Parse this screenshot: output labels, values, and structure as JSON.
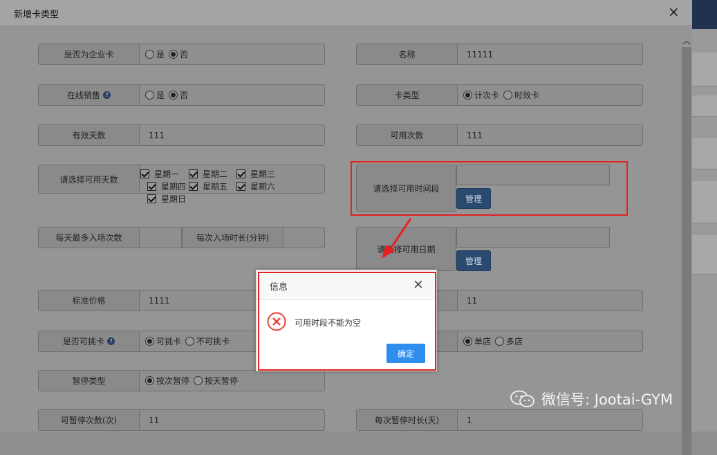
{
  "dialog": {
    "title": "新增卡类型",
    "close_glyph": "×"
  },
  "scroll_up_glyph": "︿",
  "form": {
    "enterprise": {
      "label": "是否为企业卡",
      "options": [
        "是",
        "否"
      ],
      "selected": "否"
    },
    "name": {
      "label": "名称",
      "value": "11111"
    },
    "online_sale": {
      "label": "在线销售",
      "help": "?",
      "options": [
        "是",
        "否"
      ],
      "selected": "否"
    },
    "card_type": {
      "label": "卡类型",
      "options": [
        "计次卡",
        "时效卡"
      ],
      "selected": "计次卡"
    },
    "valid_days": {
      "label": "有效天数",
      "value": "111"
    },
    "usable_times": {
      "label": "可用次数",
      "value": "111"
    },
    "usable_days": {
      "label": "请选择可用天数",
      "days": [
        "星期一",
        "星期二",
        "星期三",
        "星期四",
        "星期五",
        "星期六",
        "星期日"
      ],
      "all_checked": true
    },
    "time_slot": {
      "label": "请选择可用时间段",
      "button": "管理"
    },
    "daily_max": {
      "label": "每天最多入场次数",
      "value": ""
    },
    "duration": {
      "label": "每次入场时长(分钟)",
      "value": ""
    },
    "usable_date": {
      "label": "请选择可用日期",
      "button": "管理"
    },
    "std_price": {
      "label": "标准价格",
      "value": "1111"
    },
    "right_price": {
      "value": "11"
    },
    "transferable": {
      "label": "是否可挑卡",
      "help": "?",
      "options": [
        "可挑卡",
        "不可挑卡"
      ],
      "selected": "可挑卡"
    },
    "store": {
      "options": [
        "单店",
        "多店"
      ],
      "selected": "单店"
    },
    "pause_type": {
      "label": "暂停类型",
      "options": [
        "按次暂停",
        "按天暂停"
      ],
      "selected": "按次暂停"
    },
    "pause_count": {
      "label": "可暂停次数(次)",
      "value": "11"
    },
    "pause_duration": {
      "label": "每次暂停时长(天)",
      "value": "1"
    }
  },
  "message": {
    "title": "信息",
    "close_glyph": "×",
    "text": "可用时段不能为空",
    "ok": "确定"
  },
  "watermark": {
    "text": "微信号: Jootai-GYM"
  },
  "colors": {
    "highlight_red": "#e32222",
    "ok_blue": "#2e8ded",
    "error_red": "#e8413b"
  }
}
